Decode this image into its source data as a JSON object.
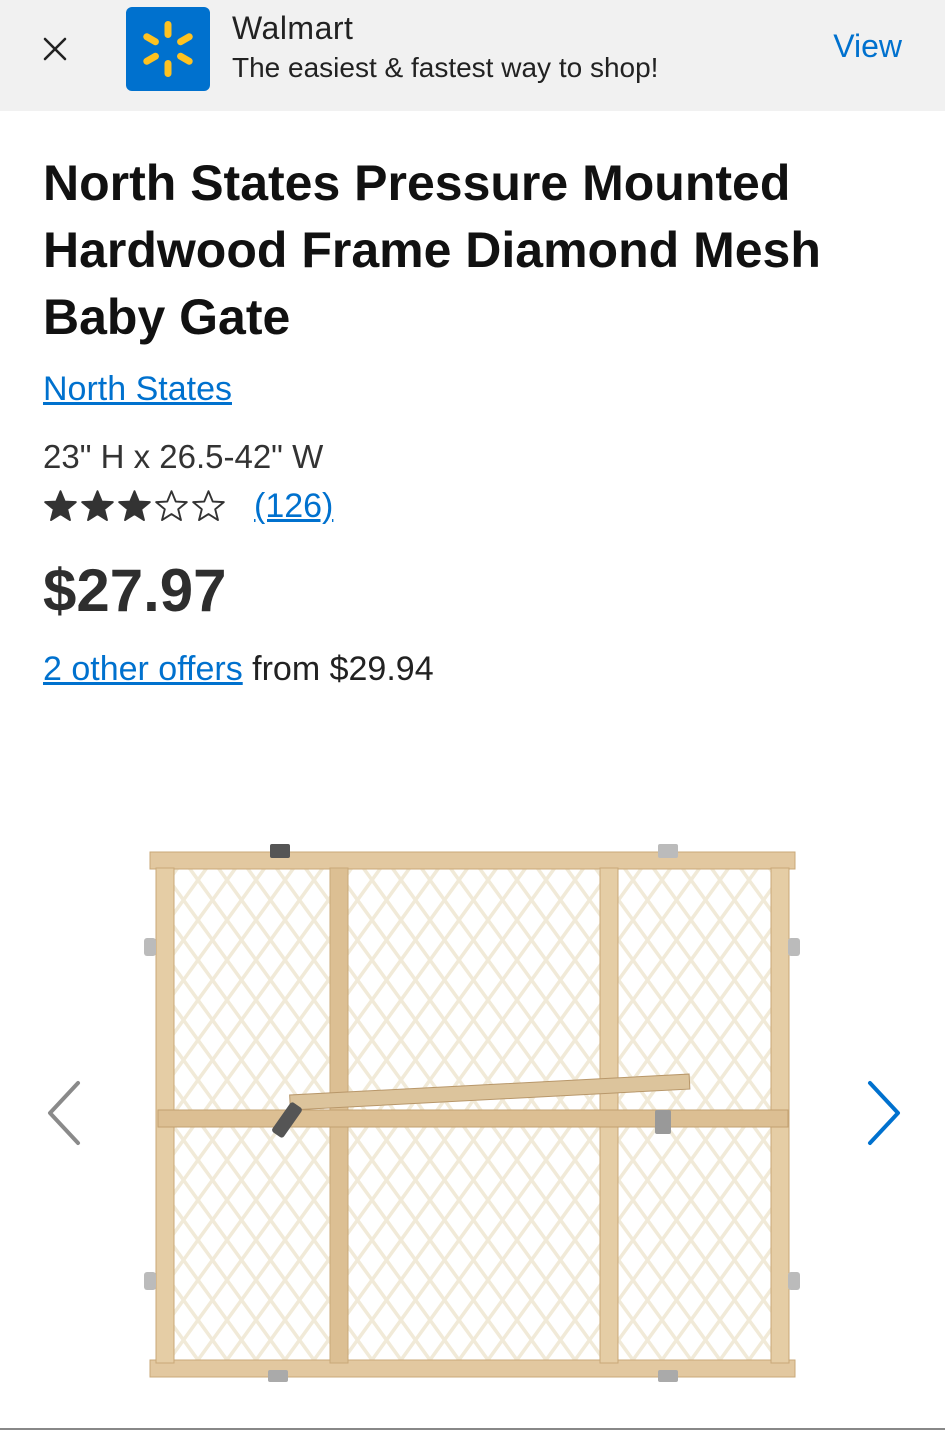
{
  "banner": {
    "app_name": "Walmart",
    "tagline": "The easiest & fastest way to shop!",
    "view_label": "View",
    "close_icon": "close-icon",
    "logo_icon": "walmart-spark-logo",
    "brand_color": "#0071ce",
    "spark_color": "#ffc220"
  },
  "product": {
    "title": "North States Pressure Mounted Hardwood Frame Diamond Mesh Baby Gate",
    "brand": "North States",
    "dimensions": "23\" H x 26.5-42\" W",
    "rating": 3,
    "rating_max": 5,
    "review_count": "(126)",
    "price": "$27.97",
    "offers_link": "2 other offers",
    "offers_suffix": " from $29.94"
  },
  "gallery": {
    "prev_icon": "chevron-left-icon",
    "next_icon": "chevron-right-icon",
    "image_subject": "baby-gate-image"
  }
}
